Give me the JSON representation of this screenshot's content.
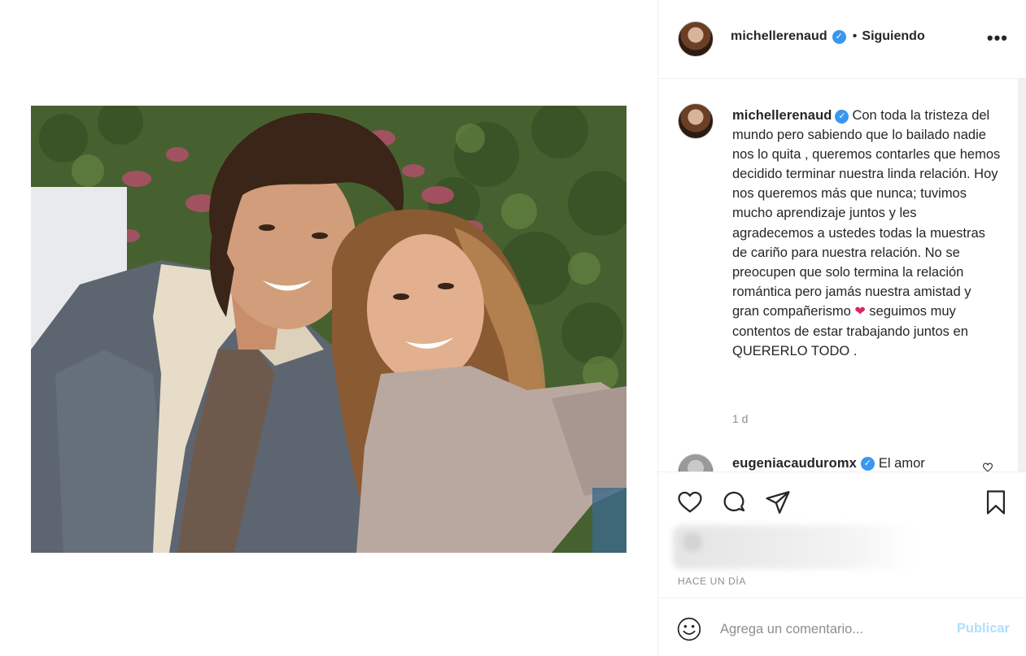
{
  "post": {
    "username": "michellerenaud",
    "follow_state": "Siguiendo",
    "separator": "•",
    "more_icon": "more-horizontal-icon"
  },
  "caption": {
    "username": "michellerenaud",
    "text_part1": "Con toda la tristeza del mundo pero sabiendo que lo bailado nadie nos lo quita , queremos contarles que hemos decidido terminar nuestra linda relación. Hoy nos queremos más que nunca; tuvimos mucho aprendizaje juntos y les agradecemos a ustedes todas la muestras de cariño para nuestra relación. No se preocupen que solo termina la relación romántica pero jamás nuestra amistad y gran compañerismo",
    "emoji": "❤",
    "text_part2": "seguimos muy contentos de estar trabajando juntos en QUERERLO TODO .",
    "time": "1 d"
  },
  "comment": {
    "username": "eugeniacauduromx",
    "text": "El amor"
  },
  "actions": {
    "like_icon": "heart-outline-icon",
    "comment_icon": "comment-bubble-icon",
    "share_icon": "paper-plane-icon",
    "save_icon": "bookmark-icon"
  },
  "post_date": "HACE UN DÍA",
  "add_comment": {
    "placeholder": "Agrega un comentario...",
    "publish_label": "Publicar"
  },
  "colors": {
    "verified": "#3897f0",
    "publish_disabled": "#b2dffc",
    "muted_text": "#8e8e8e",
    "border": "#efefef"
  }
}
